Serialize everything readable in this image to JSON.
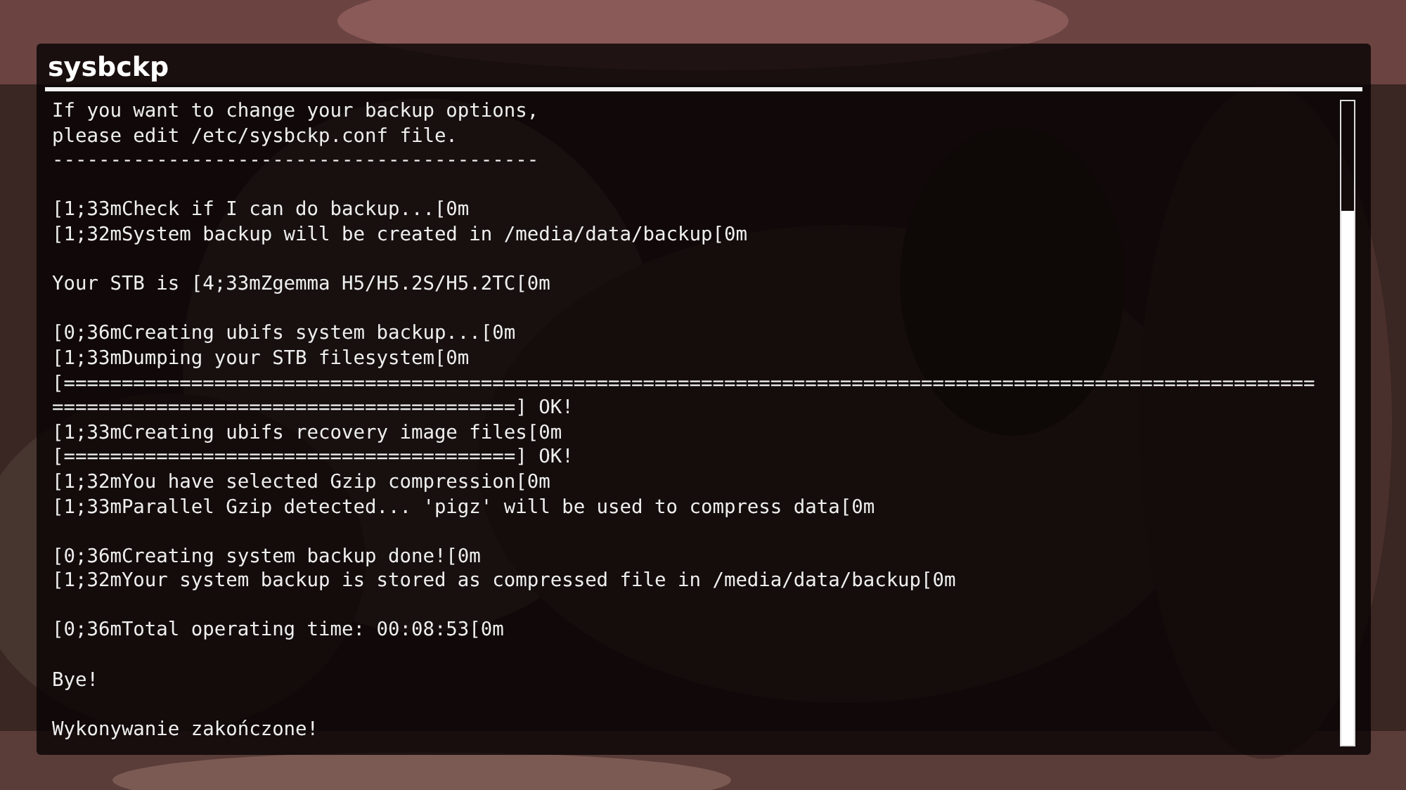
{
  "window": {
    "title": "sysbckp"
  },
  "output": {
    "blocks": [
      [
        "If you want to change your backup options,",
        "please edit /etc/sysbckp.conf file.",
        "------------------------------------------"
      ],
      [
        "[1;33mCheck if I can do backup...[0m",
        "[1;32mSystem backup will be created in /media/data/backup[0m"
      ],
      [
        "Your STB is [4;33mZgemma H5/H5.2S/H5.2TC[0m"
      ],
      [
        "[0;36mCreating ubifs system backup...[0m",
        "[1;33mDumping your STB filesystem[0m",
        "[============================================================================================================",
        "========================================] OK!",
        "[1;33mCreating ubifs recovery image files[0m",
        "[=======================================] OK!",
        "[1;32mYou have selected Gzip compression[0m",
        "[1;33mParallel Gzip detected... 'pigz' will be used to compress data[0m"
      ],
      [
        "[0;36mCreating system backup done![0m",
        "[1;32mYour system backup is stored as compressed file in /media/data/backup[0m"
      ],
      [
        "[0;36mTotal operating time: 00:08:53[0m"
      ],
      [
        "Bye!"
      ],
      [
        "Wykonywanie zakończone!"
      ]
    ]
  }
}
